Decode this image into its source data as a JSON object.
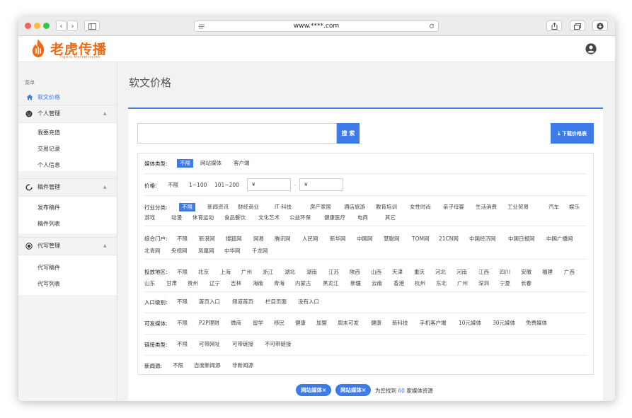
{
  "browser": {
    "url": "www.****.com",
    "nav_back": "‹",
    "nav_forward": "›",
    "colors": {
      "close": "#fc605b",
      "minimize": "#fdbc40",
      "maximize": "#34c84a"
    }
  },
  "brand": {
    "logo_text": "老虎传播",
    "logo_sub": "Tigers Marketission",
    "accent": "#ea6a15",
    "primary": "#3d7be6"
  },
  "sidebar": {
    "caption": "菜单",
    "active_item": "软文价格",
    "groups": [
      {
        "label": "个人管理",
        "items": [
          "我要充值",
          "交易记录",
          "个人信息"
        ]
      },
      {
        "label": "稿件管理",
        "items": [
          "发布稿件",
          "稿件列表"
        ]
      },
      {
        "label": "代写管理",
        "items": [
          "代写稿件",
          "代写列表"
        ]
      }
    ]
  },
  "main": {
    "page_title": "软文价格",
    "search_button": "搜 索",
    "download_button": "下载价格表",
    "filters": {
      "media_type": {
        "label": "媒体类型:",
        "options": [
          "不限",
          "网站媒体",
          "客户端"
        ]
      },
      "price": {
        "label": "价格:",
        "options": [
          "不限",
          "1~100",
          "101~200"
        ],
        "from_prefix": "¥",
        "to_prefix": "¥",
        "separator": "-"
      },
      "industry": {
        "label": "行业分类:",
        "line1": [
          "不限",
          "新闻资讯",
          "财经商业",
          "IT·科技",
          "房产家居",
          "酒店旅游",
          "教育培训",
          "女性时尚",
          "亲子母婴",
          "生活消费",
          "工业贸易",
          "汽车",
          "娱乐"
        ],
        "line2": [
          "游戏",
          "动漫",
          "体育运动",
          "食品餐饮",
          "文化艺术",
          "公益环保",
          "健康医疗",
          "电商",
          "其它"
        ]
      },
      "portal": {
        "label": "综合门户:",
        "line1": [
          "不限",
          "新浪网",
          "搜狐网",
          "网易",
          "腾讯网",
          "人民网",
          "新华网",
          "中国网",
          "慧聪网",
          "TOM网",
          "21CN网",
          "中国经济网",
          "中国日报网",
          "中国广播网"
        ],
        "line2": [
          "北青网",
          "央视网",
          "凤凰网",
          "中华网",
          "千龙网"
        ]
      },
      "region": {
        "label": "投放地区:",
        "line1": [
          "不限",
          "北京",
          "上海",
          "广州",
          "浙江",
          "湖北",
          "湖南",
          "江苏",
          "陕西",
          "山西",
          "天津",
          "重庆",
          "河北",
          "河南",
          "江西",
          "四川",
          "安徽",
          "福建",
          "广西"
        ],
        "line2": [
          "山东",
          "甘肃",
          "贵州",
          "辽宁",
          "吉林",
          "海南",
          "青海",
          "内蒙古",
          "黑龙江",
          "新疆",
          "云南",
          "香港",
          "杭州",
          "东北",
          "广州",
          "深圳",
          "宁夏",
          "长春"
        ]
      },
      "entry_level": {
        "label": "入口级别:",
        "options": [
          "不限",
          "首页入口",
          "频道首页",
          "栏目页面",
          "没有入口"
        ]
      },
      "publishable": {
        "label": "可发媒体:",
        "options": [
          "不限",
          "P2P理财",
          "微商",
          "留学",
          "移民",
          "健康",
          "加盟",
          "周末可发",
          "健康",
          "新科技",
          "手机客户端",
          "10元媒体",
          "30元媒体",
          "免费媒体"
        ]
      },
      "link_type": {
        "label": "链接类型:",
        "options": [
          "不限",
          "可带网址",
          "可带链接",
          "不可带链接"
        ]
      },
      "news_source": {
        "label": "新闻源:",
        "options": [
          "不限",
          "百度新闻源",
          "非新闻源"
        ]
      }
    },
    "selected_tags": [
      "网站媒体×",
      "网站媒体×"
    ],
    "result": {
      "prefix": "为您找到",
      "count": "60",
      "suffix": "家媒体资源"
    }
  }
}
